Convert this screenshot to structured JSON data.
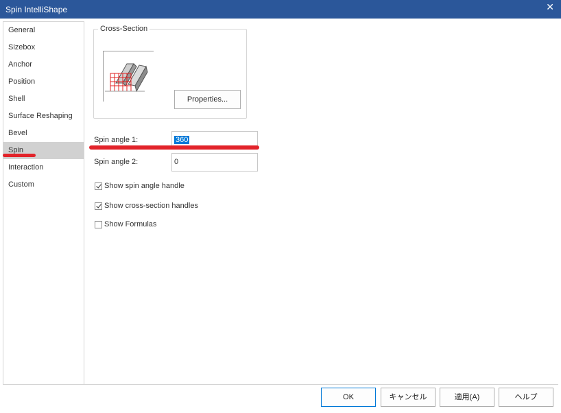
{
  "window": {
    "title": "Spin IntelliShape",
    "close_glyph": "✕"
  },
  "sidebar": {
    "items": [
      {
        "label": "General"
      },
      {
        "label": "Sizebox"
      },
      {
        "label": "Anchor"
      },
      {
        "label": "Position"
      },
      {
        "label": "Shell"
      },
      {
        "label": "Surface Reshaping"
      },
      {
        "label": "Bevel"
      },
      {
        "label": "Spin",
        "active": true
      },
      {
        "label": "Interaction"
      },
      {
        "label": "Custom"
      }
    ]
  },
  "cross_section": {
    "legend": "Cross-Section",
    "properties_label": "Properties..."
  },
  "spin": {
    "angle1_label": "Spin angle 1:",
    "angle1_value": "360",
    "angle2_label": "Spin angle 2:",
    "angle2_value": "0"
  },
  "options": {
    "show_spin_angle_handle": {
      "label": "Show spin angle handle",
      "checked": true
    },
    "show_cross_section_handles": {
      "label": "Show cross-section handles",
      "checked": true
    },
    "show_formulas": {
      "label": "Show Formulas",
      "checked": false
    }
  },
  "footer": {
    "ok": "OK",
    "cancel": "キャンセル",
    "apply": "適用(A)",
    "help": "ヘルプ"
  },
  "colors": {
    "titlebar": "#2b579a",
    "selection": "#0078d7",
    "annotation_red": "#e2232a",
    "active_item": "#d1d1d1"
  }
}
